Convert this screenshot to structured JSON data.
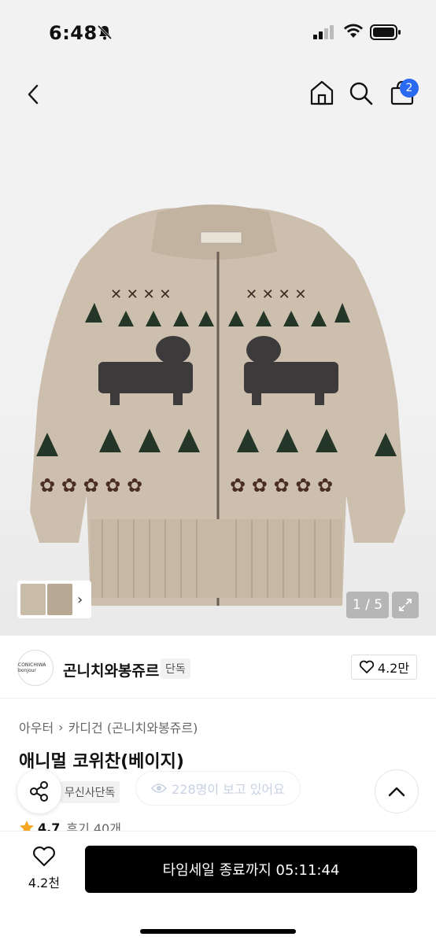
{
  "status_bar": {
    "time": "6:48"
  },
  "nav": {
    "cart_badge": "2"
  },
  "gallery": {
    "counter": "1 / 5"
  },
  "brand": {
    "name": "곤니치와봉쥬르",
    "tag": "단독",
    "logo_text": "CONICHIWA bonjour",
    "likes": "4.2만"
  },
  "breadcrumb": {
    "level1": "아우터",
    "level2": "카디건 (곤니치와봉쥬르)"
  },
  "product": {
    "title": "애니멀 코위찬(베이지)",
    "exclusive_tag": "무신사단독",
    "viewers": "228명이 보고 있어요",
    "rating": "4.7",
    "reviews": "후기 40개"
  },
  "bottom": {
    "wish_count": "4.2천",
    "cta_label": "타임세일 종료까지 05:11:44"
  },
  "colors": {
    "accent": "#2a6af3",
    "cta_bg": "#000000",
    "rating_star": "#f5a623"
  }
}
